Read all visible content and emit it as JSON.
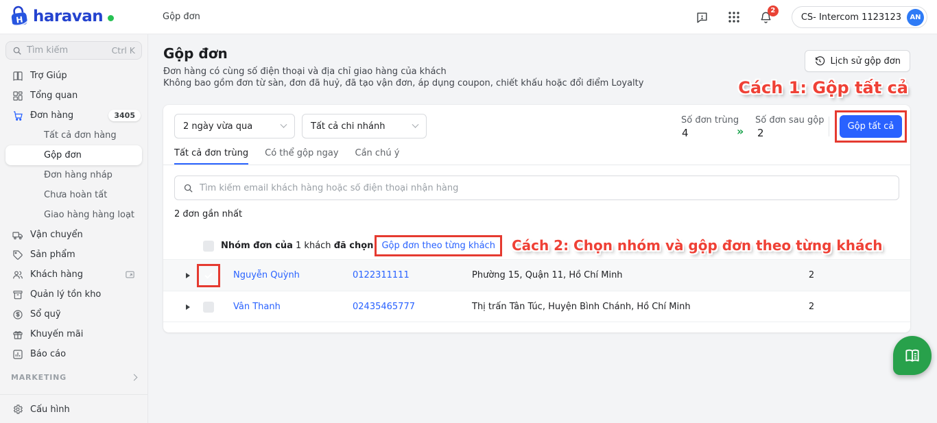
{
  "topbar": {
    "logo_text": "haravan",
    "breadcrumb": "Gộp đơn",
    "notification_count": "2",
    "account_label": "CS- Intercom 1123123",
    "avatar_initials": "AN"
  },
  "sidebar": {
    "search_placeholder": "Tìm kiếm",
    "search_shortcut": "Ctrl K",
    "items": [
      {
        "label": "Trợ Giúp"
      },
      {
        "label": "Tổng quan"
      },
      {
        "label": "Đơn hàng",
        "badge": "3405"
      },
      {
        "label": "Tất cả đơn hàng"
      },
      {
        "label": "Gộp đơn"
      },
      {
        "label": "Đơn hàng nháp"
      },
      {
        "label": "Chưa hoàn tất"
      },
      {
        "label": "Giao hàng hàng loạt"
      },
      {
        "label": "Vận chuyển"
      },
      {
        "label": "Sản phẩm"
      },
      {
        "label": "Khách hàng"
      },
      {
        "label": "Quản lý tồn kho"
      },
      {
        "label": "Sổ quỹ"
      },
      {
        "label": "Khuyến mãi"
      },
      {
        "label": "Báo cáo"
      }
    ],
    "marketing_label": "MARKETING",
    "config_label": "Cấu hình"
  },
  "page": {
    "title": "Gộp đơn",
    "description_line1": "Đơn hàng có cùng số điện thoại và địa chỉ giao hàng của khách",
    "description_line2": "Không bao gồm đơn từ sàn, đơn đã huỷ, đã tạo vận đơn, áp dụng coupon, chiết khấu hoặc đổi điểm Loyalty",
    "history_button_label": "Lịch sử gộp đơn"
  },
  "annotations": {
    "method1": "Cách 1: Gộp tất cả",
    "method2": "Cách 2: Chọn nhóm và gộp đơn theo từng khách"
  },
  "filters": {
    "date_range": "2 ngày vừa qua",
    "branch": "Tất cả chi nhánh"
  },
  "stats": {
    "duplicate_label": "Số đơn trùng",
    "duplicate_value": "4",
    "arrow_glyph": "»",
    "merged_label": "Số đơn sau gộp",
    "merged_value": "2"
  },
  "merge_all_label": "Gộp tất cả",
  "tabs": [
    {
      "label": "Tất cả đơn trùng"
    },
    {
      "label": "Có thể gộp ngay"
    },
    {
      "label": "Cần chú ý"
    }
  ],
  "search": {
    "placeholder": "Tìm kiếm email khách hàng hoặc số điện thoại nhận hàng"
  },
  "list": {
    "recent_label": "2 đơn gần nhất",
    "header": {
      "selection_bold1": "Nhóm đơn của",
      "selection_mid": " 1 khách ",
      "selection_bold2": "đã chọn",
      "merge_link_label": "Gộp đơn theo từng khách"
    },
    "rows": [
      {
        "name": "Nguyễn Quỳnh",
        "phone": "0122311111",
        "address": "Phường 15, Quận 11, Hồ Chí Minh",
        "count": "2"
      },
      {
        "name": "Vân Thanh",
        "phone": "02435465777",
        "address": "Thị trấn Tân Túc, Huyện Bình Chánh, Hồ Chí Minh",
        "count": "2"
      }
    ]
  },
  "colors": {
    "accent_blue": "#2962ff",
    "annotation_red": "#ef4136",
    "box_red": "#e53a30",
    "arrow_green": "#17a24a",
    "widget_green": "#28a14b",
    "badge_red": "#e94235"
  }
}
